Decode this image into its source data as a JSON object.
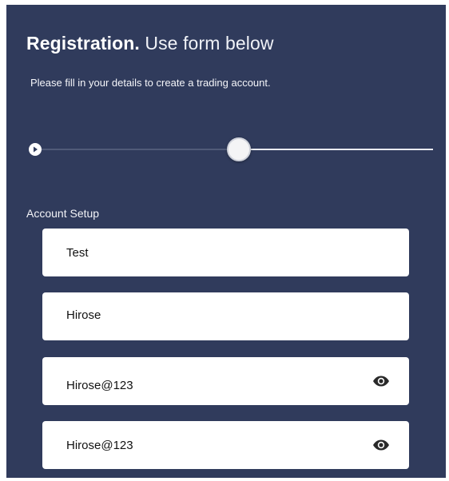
{
  "header": {
    "title_bold": "Registration.",
    "title_light": "Use form below",
    "subtitle": "Please fill in your details to create a trading account."
  },
  "progress": {
    "current_step": 2,
    "position_fraction": 0.52
  },
  "section": {
    "label": "Account Setup"
  },
  "fields": [
    {
      "value": "Test"
    },
    {
      "value": "Hirose"
    },
    {
      "value": "Hirose@123",
      "icon": "eye-icon"
    },
    {
      "value": "Hirose@123",
      "icon": "eye-icon"
    }
  ],
  "colors": {
    "panel_background": "#303b5c",
    "field_background": "#ffffff",
    "text": "#ffffff"
  }
}
